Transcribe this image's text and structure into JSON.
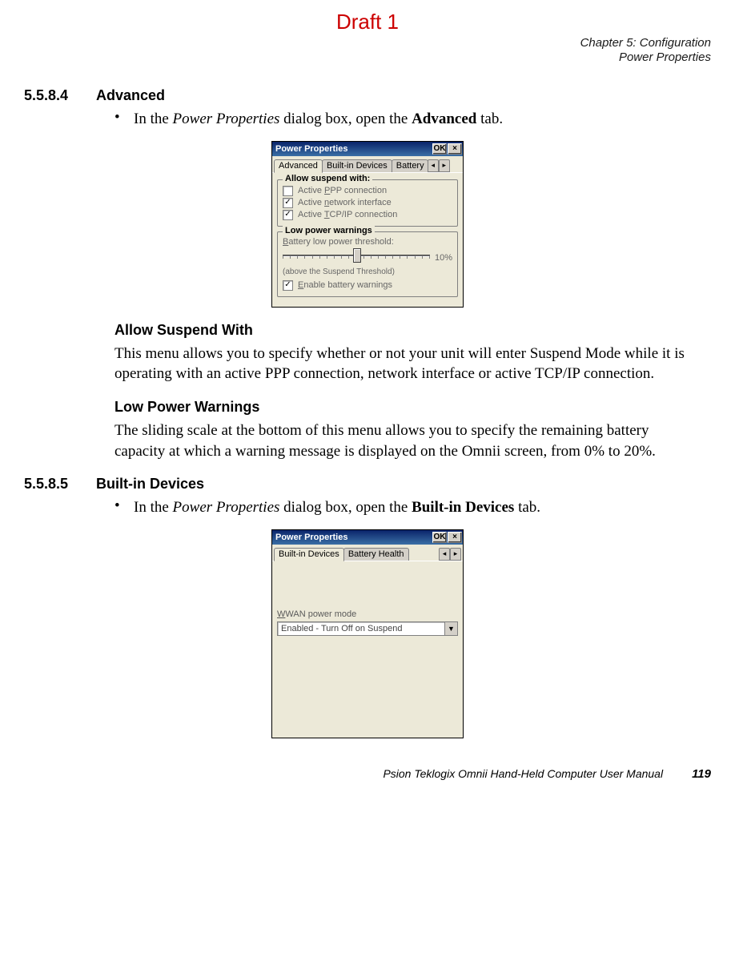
{
  "draft_label": "Draft 1",
  "chapter_line": "Chapter 5: Configuration",
  "chapter_sub": "Power Properties",
  "sections": {
    "adv": {
      "num": "5.5.8.4",
      "title": "Advanced",
      "bullet_prefix": "In the ",
      "bullet_italic": "Power Properties",
      "bullet_mid": " dialog box, open the ",
      "bullet_bold": "Advanced",
      "bullet_suffix": " tab.",
      "sub1": "Allow Suspend With",
      "sub1_text": "This menu allows you to specify whether or not your unit will enter Suspend Mode while it is operating with an active PPP connection, network interface or active TCP/IP connection.",
      "sub2": "Low Power Warnings",
      "sub2_text": "The sliding scale at the bottom of this menu allows you to specify the remaining battery capacity at which a warning message is displayed on the Omnii screen, from 0% to 20%."
    },
    "builtin": {
      "num": "5.5.8.5",
      "title": "Built-in Devices",
      "bullet_prefix": "In the ",
      "bullet_italic": "Power Properties",
      "bullet_mid": " dialog box, open the ",
      "bullet_bold": "Built-in Devices",
      "bullet_suffix": " tab."
    }
  },
  "dialog1": {
    "title": "Power Properties",
    "ok": "OK",
    "close": "×",
    "tabs": [
      "Advanced",
      "Built-in Devices",
      "Battery"
    ],
    "group1": {
      "legend": "Allow suspend with:",
      "items": [
        {
          "label_pre": "Active ",
          "ul": "P",
          "label_post": "PP connection",
          "checked": false
        },
        {
          "label_pre": "Active ",
          "ul": "n",
          "label_post": "etwork interface",
          "checked": true
        },
        {
          "label_pre": "Active ",
          "ul": "T",
          "label_post": "CP/IP connection",
          "checked": true
        }
      ]
    },
    "group2": {
      "legend": "Low power warnings",
      "battery_label_pre": "",
      "battery_label_ul": "B",
      "battery_label_post": "attery low power threshold:",
      "value": "10%",
      "note": "(above the Suspend Threshold)",
      "enable_ul": "E",
      "enable_post": "nable battery warnings",
      "enable_checked": true
    }
  },
  "dialog2": {
    "title": "Power Properties",
    "ok": "OK",
    "close": "×",
    "tabs": [
      "Built-in Devices",
      "Battery Health"
    ],
    "label_ul": "W",
    "label_post": "WAN power mode",
    "combo_value": "Enabled - Turn Off on Suspend"
  },
  "footer": {
    "title": "Psion Teklogix Omnii Hand-Held Computer User Manual",
    "page": "119"
  }
}
